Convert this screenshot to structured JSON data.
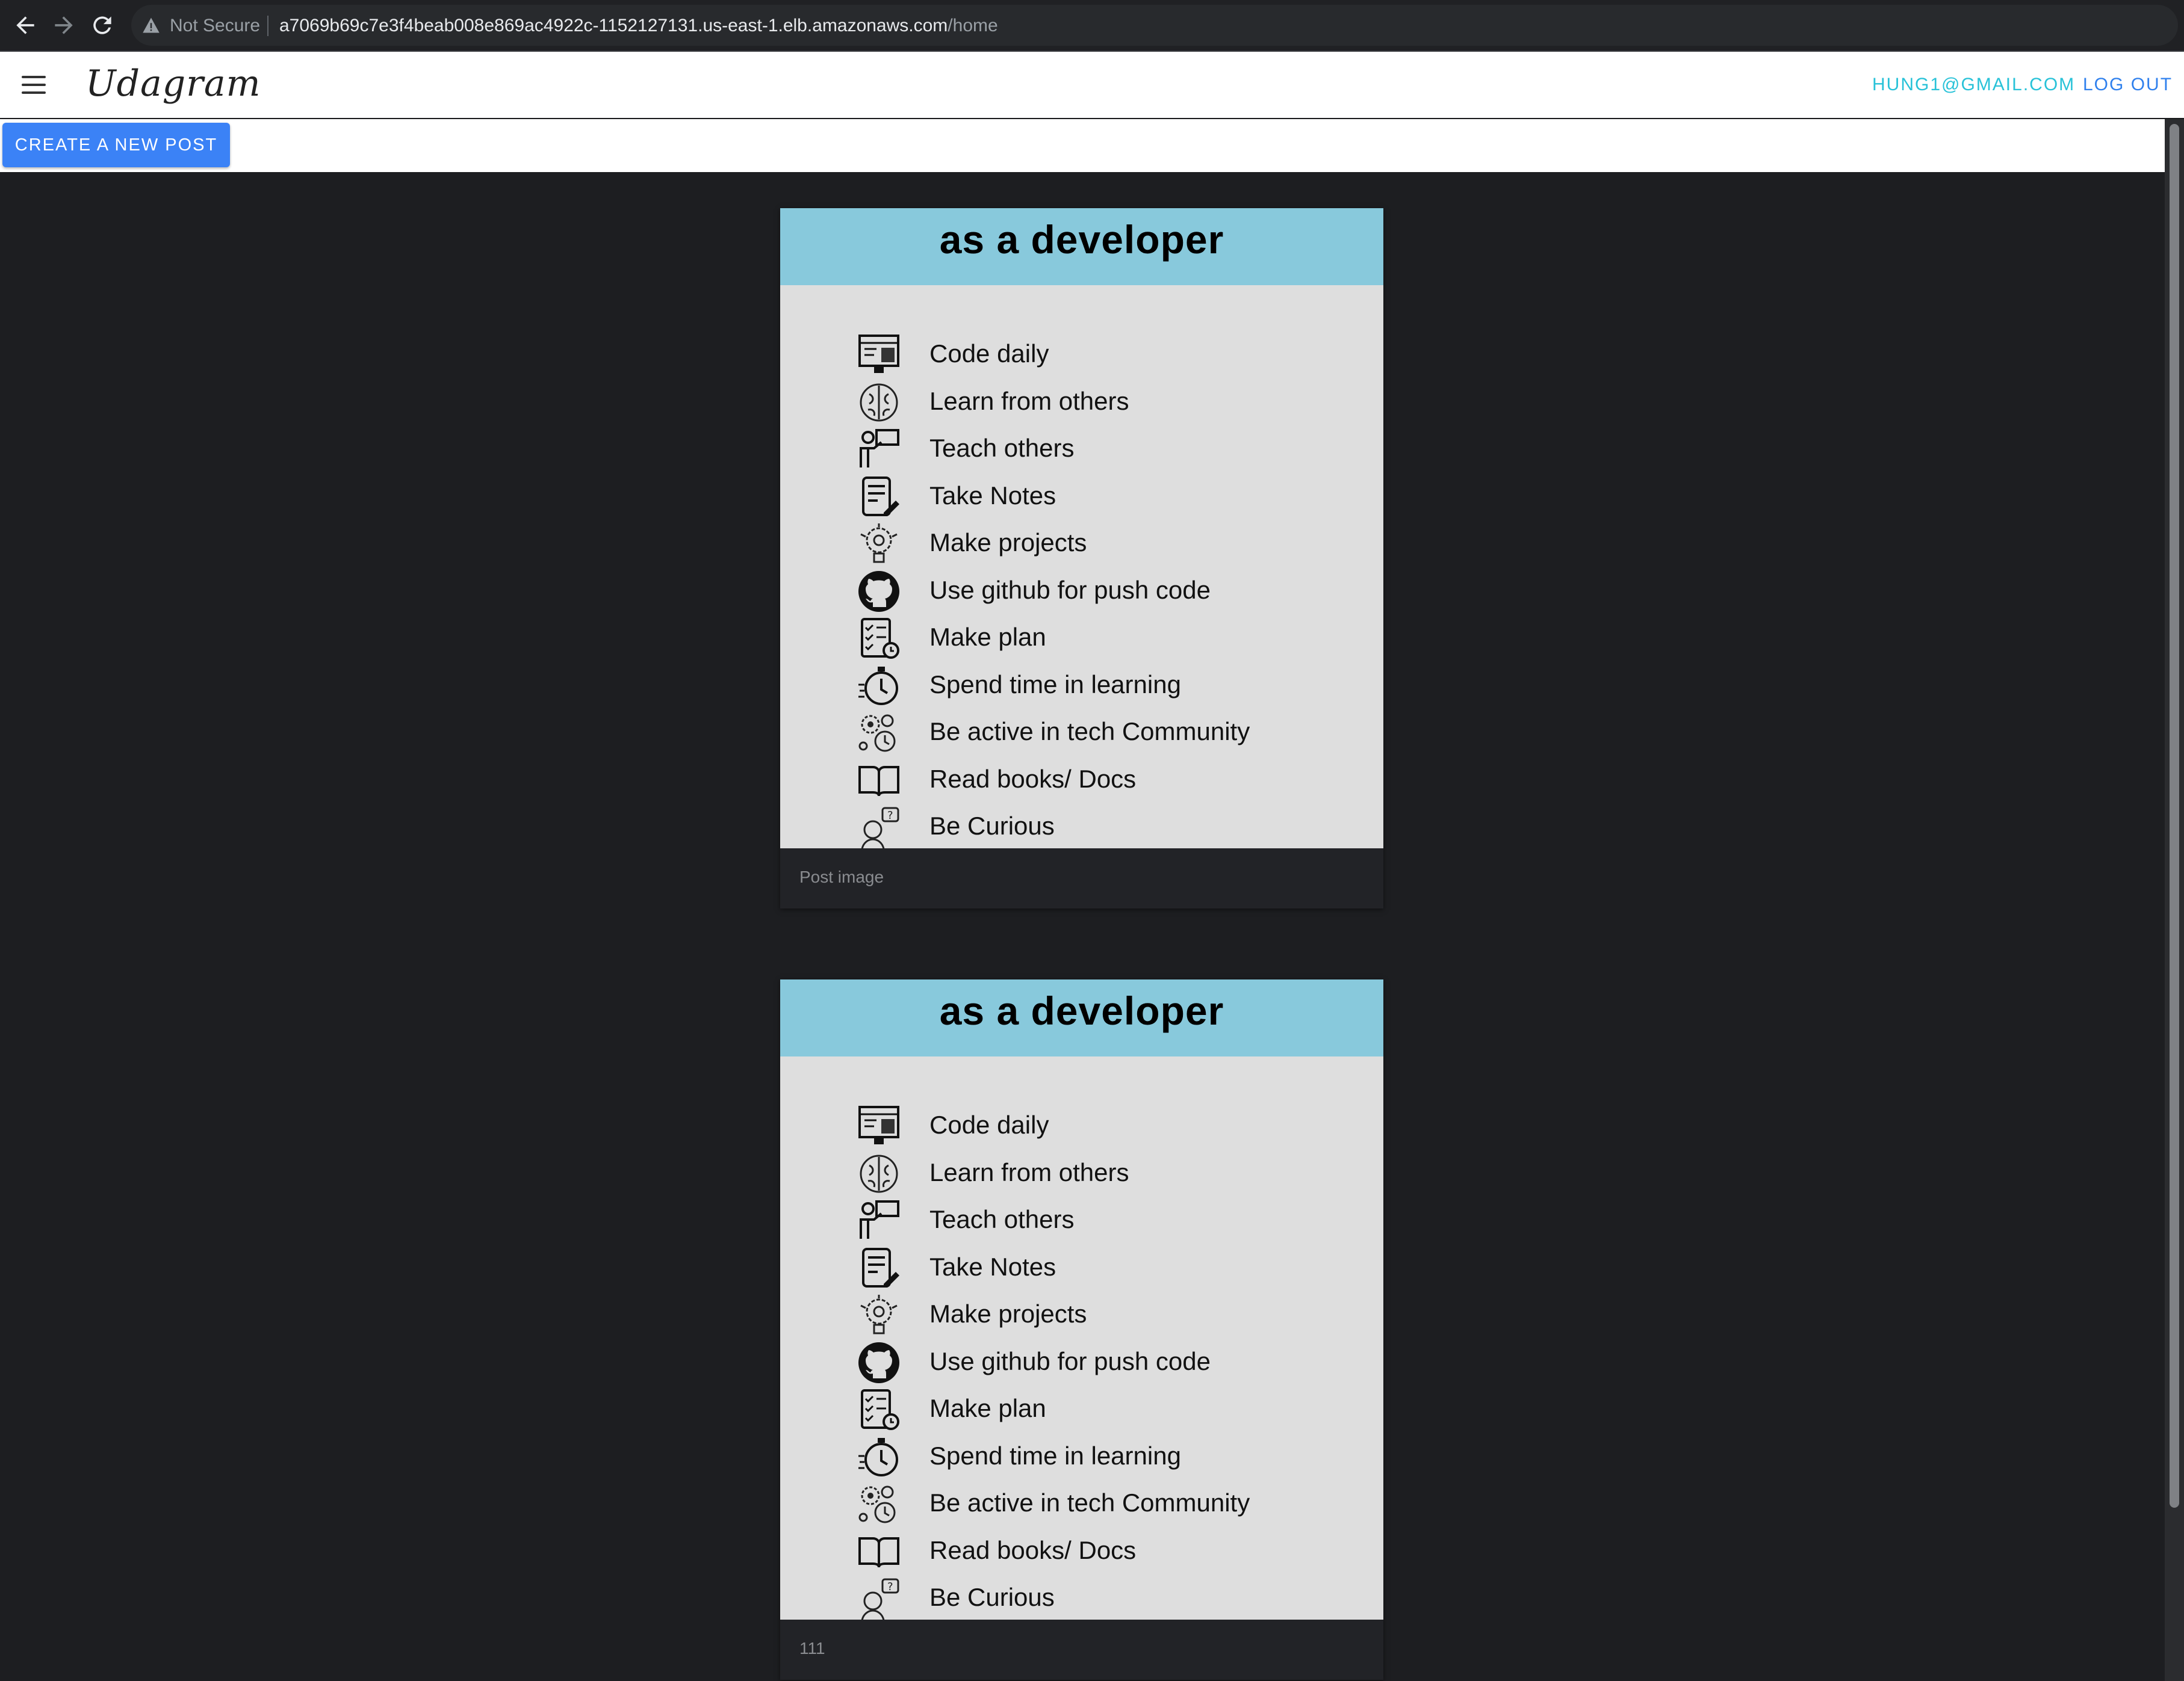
{
  "browser": {
    "security_label": "Not Secure",
    "url_host": "a7069b69c7e3f4beab008e869ac4922c-1152127131.us-east-1.elb.amazonaws.com",
    "url_path": "/home",
    "icons": [
      "back-arrow-icon",
      "forward-arrow-icon",
      "reload-icon",
      "warning-icon"
    ]
  },
  "header": {
    "brand": "Udagram",
    "user_email": "HUNG1@GMAIL.COM",
    "logout_label": "LOG OUT"
  },
  "toolbar": {
    "create_label": "CREATE A NEW POST",
    "accent": "#3b82f6"
  },
  "posts": [
    {
      "image": {
        "title": "as a developer",
        "items": [
          {
            "label": "Code daily",
            "icon": "code-screen-icon"
          },
          {
            "label": "Learn from others",
            "icon": "brain-icon"
          },
          {
            "label": "Teach others",
            "icon": "teacher-icon"
          },
          {
            "label": "Take Notes",
            "icon": "notes-icon"
          },
          {
            "label": "Make projects",
            "icon": "lightbulb-gear-icon"
          },
          {
            "label": "Use github for push code",
            "icon": "github-icon"
          },
          {
            "label": "Make plan",
            "icon": "checklist-icon"
          },
          {
            "label": "Spend time in learning",
            "icon": "stopwatch-icon"
          },
          {
            "label": "Be active in tech Community",
            "icon": "community-gears-icon"
          },
          {
            "label": "Read books/ Docs",
            "icon": "book-icon"
          },
          {
            "label": "Be Curious",
            "icon": "curious-person-icon"
          }
        ]
      },
      "caption": "Post image"
    },
    {
      "image": {
        "title": "as a developer",
        "items": [
          {
            "label": "Code daily",
            "icon": "code-screen-icon"
          },
          {
            "label": "Learn from others",
            "icon": "brain-icon"
          },
          {
            "label": "Teach others",
            "icon": "teacher-icon"
          },
          {
            "label": "Take Notes",
            "icon": "notes-icon"
          },
          {
            "label": "Make projects",
            "icon": "lightbulb-gear-icon"
          },
          {
            "label": "Use github for push code",
            "icon": "github-icon"
          },
          {
            "label": "Make plan",
            "icon": "checklist-icon"
          },
          {
            "label": "Spend time in learning",
            "icon": "stopwatch-icon"
          },
          {
            "label": "Be active in tech Community",
            "icon": "community-gears-icon"
          },
          {
            "label": "Read books/ Docs",
            "icon": "book-icon"
          },
          {
            "label": "Be Curious",
            "icon": "curious-person-icon"
          }
        ]
      },
      "caption": "111"
    }
  ]
}
